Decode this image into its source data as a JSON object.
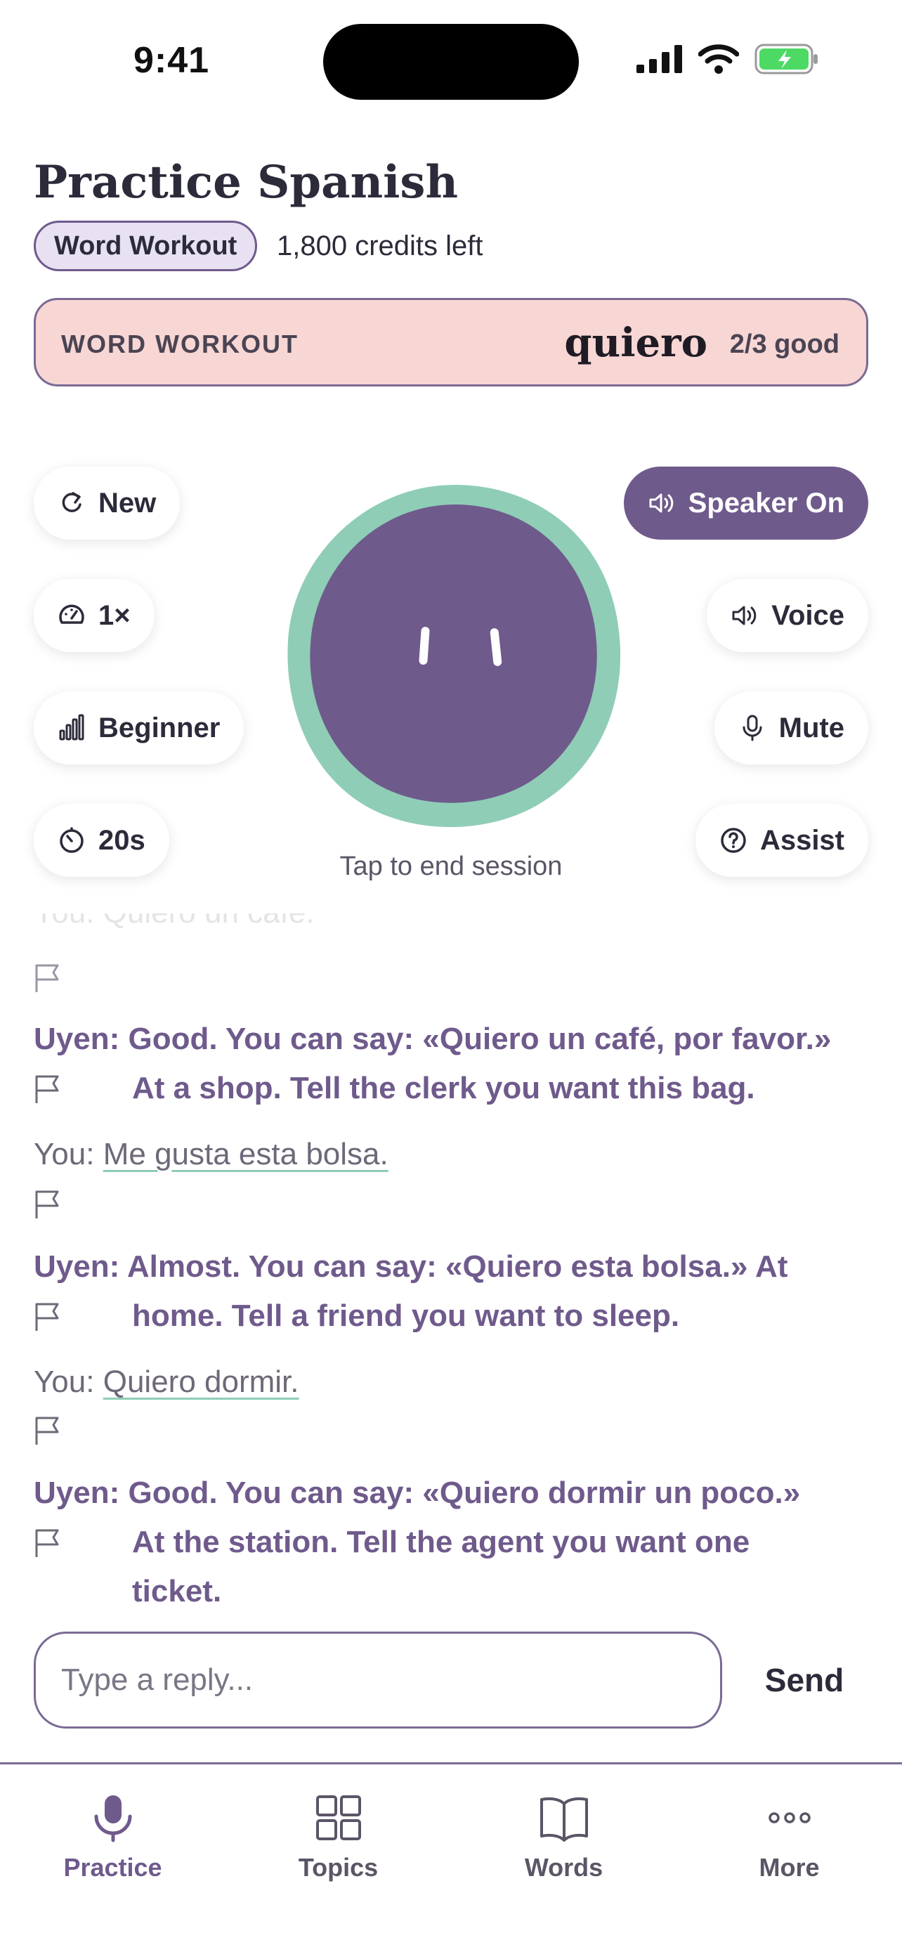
{
  "status": {
    "time": "9:41"
  },
  "header": {
    "title": "Practice Spanish",
    "mode": "Word Workout",
    "credits": "1,800 credits left"
  },
  "workout": {
    "label": "WORD WORKOUT",
    "word": "quiero",
    "score": "2/3 good"
  },
  "controls": {
    "new": "New",
    "speed": "1×",
    "level": "Beginner",
    "timer": "20s",
    "speaker": "Speaker On",
    "voice": "Voice",
    "mute": "Mute",
    "assist": "Assist"
  },
  "session": {
    "hint": "Tap to end session"
  },
  "transcript": {
    "prev_user": "You: Quiero un café.",
    "messages": [
      {
        "speaker": "Uyen:",
        "line1": "Good. You can say: «Quiero un café, por favor.»",
        "line2": "At a shop. Tell the clerk you want this bag."
      },
      {
        "speaker": "You:",
        "line1": "Me gusta esta bolsa."
      },
      {
        "speaker": "Uyen:",
        "line1": "Almost. You can say: «Quiero esta bolsa.» At",
        "line2": "home. Tell a friend you want to sleep."
      },
      {
        "speaker": "You:",
        "line1": "Quiero dormir."
      },
      {
        "speaker": "Uyen:",
        "line1": "Good. You can say: «Quiero dormir un poco.»",
        "line2": "At the station. Tell the agent you want one",
        "line3": "ticket."
      }
    ]
  },
  "composer": {
    "placeholder": "Type a reply...",
    "send": "Send"
  },
  "tabs": [
    {
      "label": "Practice",
      "icon": "mic-icon",
      "active": true
    },
    {
      "label": "Topics",
      "icon": "grid-icon"
    },
    {
      "label": "Words",
      "icon": "book-icon"
    },
    {
      "label": "More",
      "icon": "more-icon"
    }
  ],
  "colors": {
    "accent": "#6f5a8c",
    "ring": "#8fcdb6",
    "card": "#f7d6d4"
  }
}
